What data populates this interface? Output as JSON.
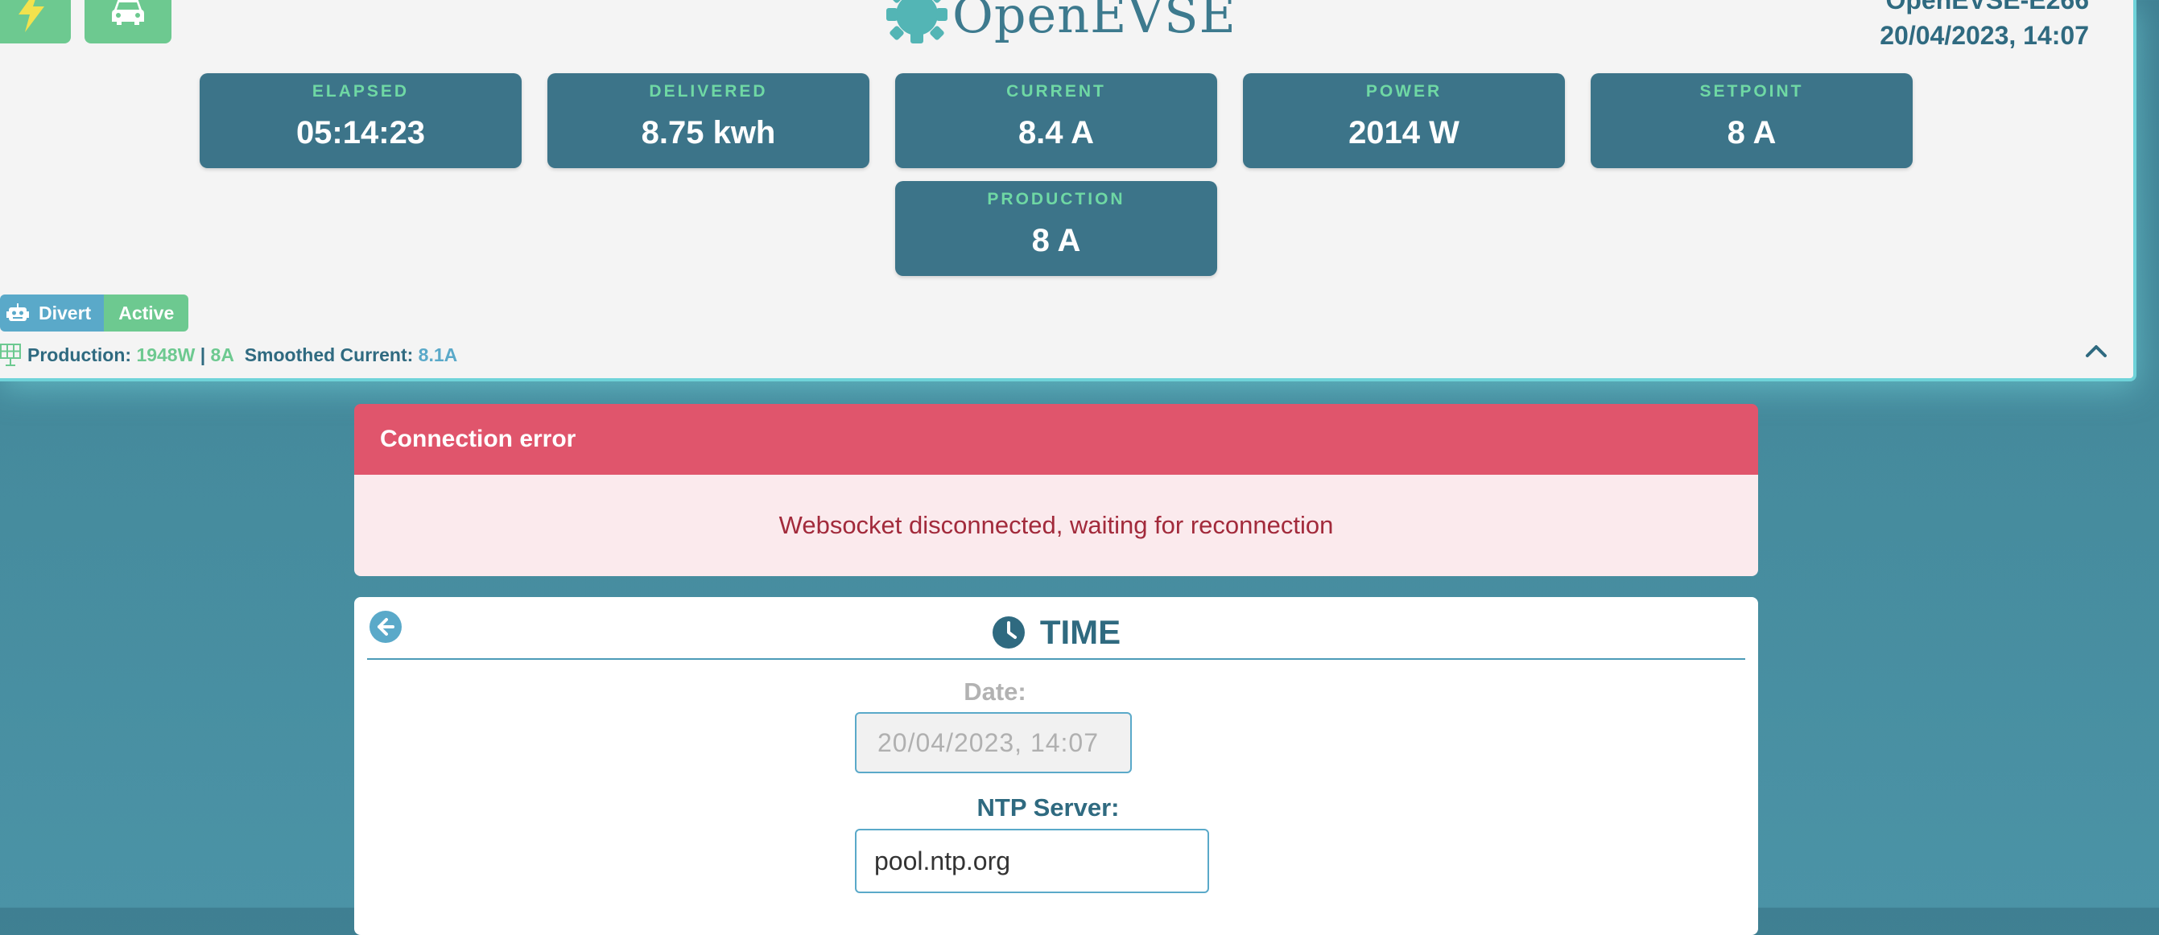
{
  "header": {
    "logo_text": "OpenEVSE",
    "device_name": "OpenEVSE-E266",
    "datetime": "20/04/2023, 14:07"
  },
  "stats": [
    {
      "label": "ELAPSED",
      "value": "05:14:23"
    },
    {
      "label": "DELIVERED",
      "value": "8.75 kwh"
    },
    {
      "label": "CURRENT",
      "value": "8.4 A"
    },
    {
      "label": "POWER",
      "value": "2014 W"
    },
    {
      "label": "SETPOINT",
      "value": "8 A"
    },
    {
      "label": "PRODUCTION",
      "value": "8 A"
    }
  ],
  "divert": {
    "mode_label": "Divert",
    "status_label": "Active",
    "production_label": "Production:",
    "production_power": "1948W",
    "separator": "|",
    "production_current": "8A",
    "smoothed_label": "Smoothed Current:",
    "smoothed_value": "8.1A"
  },
  "alert": {
    "title": "Connection error",
    "message": "Websocket disconnected, waiting for reconnection"
  },
  "time_panel": {
    "title": "TIME",
    "date_label": "Date:",
    "date_value": "20/04/2023, 14:07",
    "ntp_label": "NTP Server:",
    "ntp_value": "pool.ntp.org"
  },
  "icons": {
    "bolt": "bolt-icon",
    "car": "car-icon",
    "robot": "robot-icon",
    "solar": "solar-panel-icon",
    "collapse": "chevron-up-icon",
    "back": "arrow-left-circle-icon",
    "clock": "clock-icon"
  },
  "colors": {
    "accent_green": "#6dc990",
    "card_bg": "#3c7489",
    "label_green": "#6fd8a4",
    "header_text": "#2f6a80",
    "alert_red": "#e0556c",
    "info_blue": "#5aa9c9"
  }
}
